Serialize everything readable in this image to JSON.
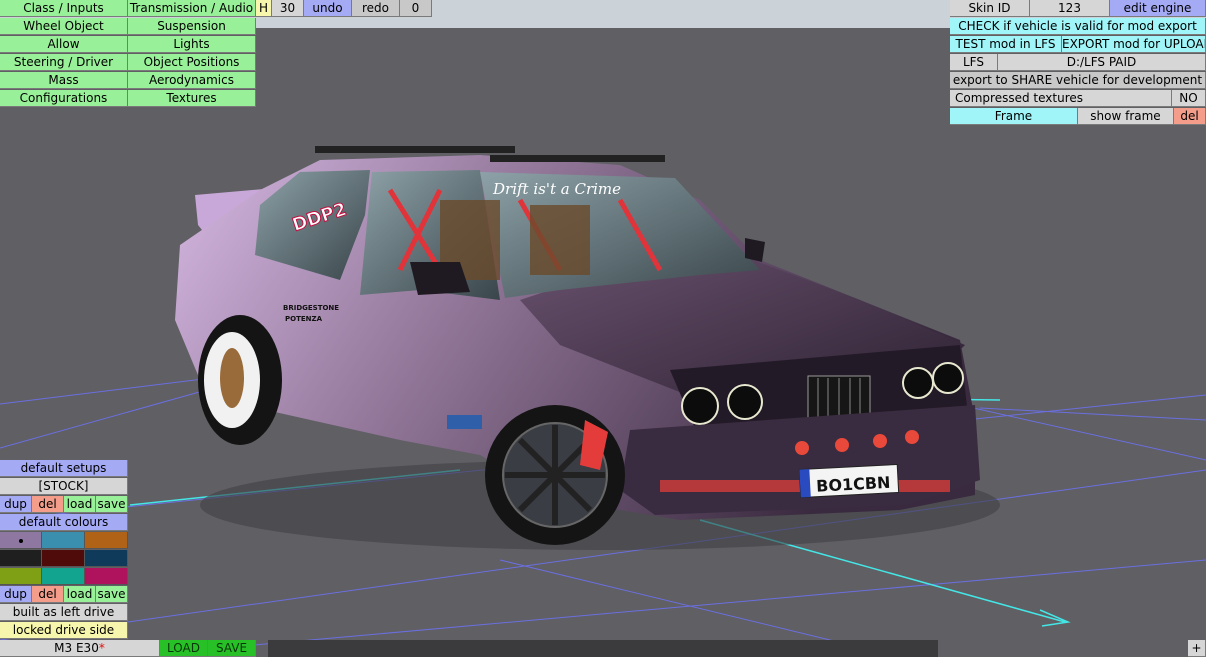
{
  "top_menu": {
    "left_col": [
      "Class / Inputs",
      "Wheel Object",
      "Allow",
      "Steering / Driver",
      "Mass",
      "Configurations"
    ],
    "right_col": [
      "Transmission / Audio",
      "Suspension",
      "Lights",
      "Object Positions",
      "Aerodynamics",
      "Textures"
    ],
    "h_label": "H",
    "h_value": "30",
    "undo_label": "undo",
    "redo_label": "redo",
    "redo_count": "0"
  },
  "right_panel": {
    "skin_id_label": "Skin ID",
    "skin_id_value": "123",
    "edit_engine_label": "edit engine",
    "check_valid_label": "CHECK if vehicle is valid for mod export",
    "test_mod_label": "TEST mod in LFS",
    "export_mod_label": "EXPORT mod for UPLOAD",
    "lfs_label": "LFS",
    "lfs_path": "D:/LFS PAID",
    "export_share_label": "export to SHARE vehicle for development",
    "compressed_textures_label": "Compressed textures",
    "compressed_textures_value": "NO",
    "frame_label": "Frame",
    "show_frame_label": "show frame",
    "del_label": "del"
  },
  "left_panel": {
    "default_setups_label": "default setups",
    "setup_name": "[STOCK]",
    "dup_label": "dup",
    "del_label": "del",
    "load_label": "load",
    "save_label": "save",
    "default_colours_label": "default colours",
    "colour_swatches": [
      "#8e78a1",
      "#3b8fae",
      "#b06316",
      "#1f1f1f",
      "#4f0a0a",
      "#0f3a5a",
      "#7fa014",
      "#13a48f",
      "#b0135e"
    ],
    "built_as_label": "built as left drive",
    "locked_drive_label": "locked drive side"
  },
  "bottom_bar": {
    "car_name": "M3 E30",
    "modified_marker": "*",
    "load_label": "LOAD",
    "save_label": "SAVE",
    "plus_label": "+"
  },
  "scene": {
    "windshield_text": "Drift is't a Crime",
    "plate_text": "BO1CBN",
    "sticker_text": "DDP2",
    "sponsor_text": "BRIDGESTONE",
    "sponsor_sub": "POTENZA"
  },
  "colors": {
    "body": "#a890b8",
    "grid_line": "#6e73ff",
    "axis_cyan": "#45e6e6"
  }
}
